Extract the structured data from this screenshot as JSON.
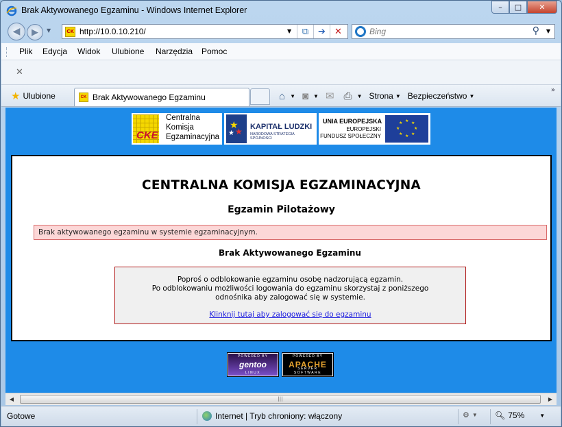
{
  "window": {
    "title": "Brak Aktywowanego Egzaminu - Windows Internet Explorer",
    "buttons": {
      "minimize": "–",
      "maximize": "□",
      "close": "✕"
    }
  },
  "address_bar": {
    "url": "http://10.0.10.210/",
    "search_placeholder": "Bing"
  },
  "menu": {
    "items": [
      "Plik",
      "Edycja",
      "Widok",
      "Ulubione",
      "Narzędzia",
      "Pomoc"
    ]
  },
  "favorites": {
    "label": "Ulubione",
    "tab_title": "Brak Aktywowanego Egzaminu"
  },
  "command_bar": {
    "page_label": "Strona",
    "safety_label": "Bezpieczeństwo"
  },
  "logos": {
    "cke_abbr": "CKE",
    "cke_lines": [
      "Centralna",
      "Komisja",
      "Egzaminacyjna"
    ],
    "kl_title": "KAPITAŁ LUDZKI",
    "kl_subtitle": "NARODOWA STRATEGIA SPÓJNOŚCI",
    "ue_title": "UNIA EUROPEJSKA",
    "ue_lines": [
      "EUROPEJSKI",
      "FUNDUSZ SPOŁECZNY"
    ]
  },
  "page": {
    "heading": "CENTRALNA KOMISJA EGZAMINACYJNA",
    "subheading": "Egzamin Pilotażowy",
    "alert": "Brak aktywowanego egzaminu w systemie egzaminacyjnym.",
    "section_title": "Brak Aktywowanego Egzaminu",
    "info_lines": [
      "Poproś o odblokowanie egzaminu osobę nadzorującą egzamin.",
      "Po odblokowaniu możliwości logowania do egzaminu skorzystaj z poniższego",
      "odnośnika aby zalogować się w systemie."
    ],
    "login_link": "Klinknij tutaj aby zalogować się do egzaminu"
  },
  "badges": {
    "gentoo": {
      "top": "POWERED BY",
      "name": "gentoo",
      "bottom": "LINUX"
    },
    "apache": {
      "top": "POWERED BY",
      "name": "APACHE",
      "bottom": "SERVER SOFTWARE"
    }
  },
  "status_bar": {
    "status": "Gotowe",
    "zone": "Internet | Tryb chroniony: włączony",
    "zoom": "75%"
  },
  "icons": {
    "back": "back-arrow-icon",
    "forward": "forward-arrow-icon",
    "refresh": "refresh-icon",
    "go": "go-arrow-icon",
    "stop": "stop-icon",
    "search": "search-icon",
    "home": "home-icon",
    "feeds": "rss-icon",
    "mail": "mail-icon",
    "print": "print-icon"
  }
}
